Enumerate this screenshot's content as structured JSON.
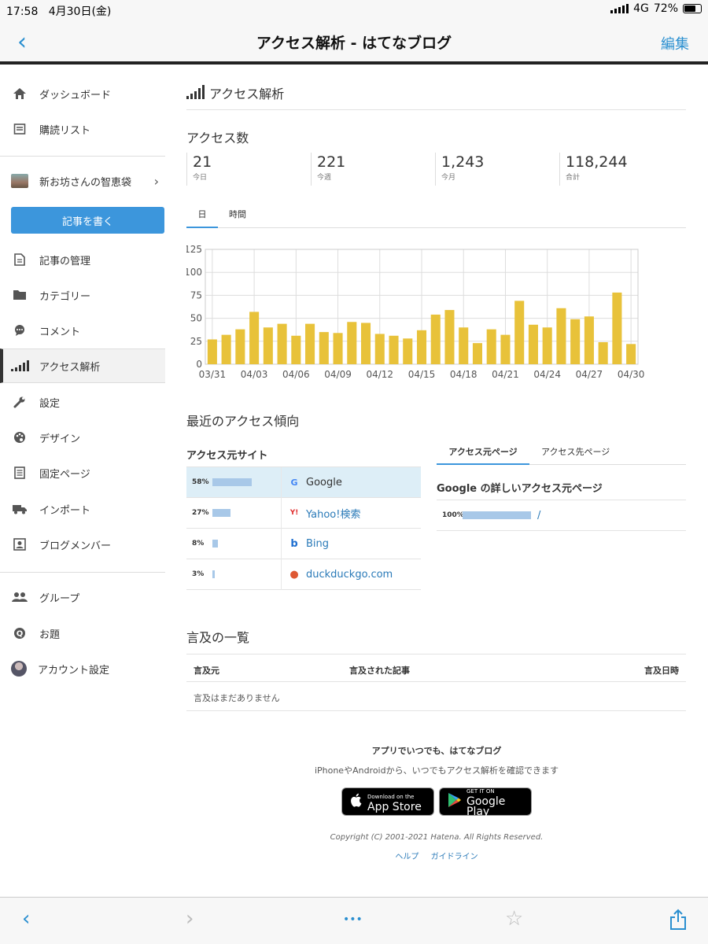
{
  "status": {
    "time": "17:58",
    "date": "4月30日(金)",
    "network": "4G",
    "battery": "72%",
    "battery_level": 0.72
  },
  "nav": {
    "back": "‹",
    "title": "アクセス解析 - はてなブログ",
    "edit": "編集"
  },
  "sidebar": {
    "items": [
      {
        "label": "ダッシュボード",
        "icon": "home-icon"
      },
      {
        "label": "購読リスト",
        "icon": "inbox-icon"
      },
      {
        "label": "新お坊さんの智恵袋",
        "icon": "blog-thumbnail"
      },
      {
        "label": "記事を書く"
      },
      {
        "label": "記事の管理",
        "icon": "document-icon"
      },
      {
        "label": "カテゴリー",
        "icon": "folder-icon"
      },
      {
        "label": "コメント",
        "icon": "comment-icon"
      },
      {
        "label": "アクセス解析",
        "icon": "signal-bars-icon"
      },
      {
        "label": "設定",
        "icon": "wrench-icon"
      },
      {
        "label": "デザイン",
        "icon": "palette-icon"
      },
      {
        "label": "固定ページ",
        "icon": "page-icon"
      },
      {
        "label": "インポート",
        "icon": "truck-icon"
      },
      {
        "label": "ブログメンバー",
        "icon": "member-icon"
      },
      {
        "label": "グループ",
        "icon": "group-icon"
      },
      {
        "label": "お題",
        "icon": "question-icon"
      },
      {
        "label": "アカウント設定",
        "icon": "avatar-icon"
      }
    ]
  },
  "main": {
    "heading": "アクセス解析",
    "access_title": "アクセス数",
    "stats": [
      {
        "value": "21",
        "label": "今日"
      },
      {
        "value": "221",
        "label": "今週"
      },
      {
        "value": "1,243",
        "label": "今月"
      },
      {
        "value": "118,244",
        "label": "合計"
      }
    ],
    "tabs": [
      "日",
      "時間"
    ],
    "trend_title": "最近のアクセス傾向",
    "sources_title": "アクセス元サイト",
    "sources": [
      {
        "pct": "58%",
        "value": 58,
        "site": "Google",
        "icon": "G"
      },
      {
        "pct": "27%",
        "value": 27,
        "site": "Yahoo!検索",
        "icon": "Y!"
      },
      {
        "pct": "8%",
        "value": 8,
        "site": "Bing",
        "icon": "b"
      },
      {
        "pct": "3%",
        "value": 3,
        "site": "duckduckgo.com",
        "icon": "●"
      }
    ],
    "right_tabs": [
      "アクセス元ページ",
      "アクセス先ページ"
    ],
    "detail_title": "Google の詳しいアクセス元ページ",
    "detail_rows": [
      {
        "pct": "100%",
        "value": 100,
        "path": "/"
      }
    ],
    "mentions_title": "言及の一覧",
    "mentions_headers": [
      "言及元",
      "言及された記事",
      "言及日時"
    ],
    "mentions_empty": "言及はまだありません"
  },
  "chart_data": {
    "type": "bar",
    "categories": [
      "03/31",
      "04/01",
      "04/02",
      "04/03",
      "04/04",
      "04/05",
      "04/06",
      "04/07",
      "04/08",
      "04/09",
      "04/10",
      "04/11",
      "04/12",
      "04/13",
      "04/14",
      "04/15",
      "04/16",
      "04/17",
      "04/18",
      "04/19",
      "04/20",
      "04/21",
      "04/22",
      "04/23",
      "04/24",
      "04/25",
      "04/26",
      "04/27",
      "04/28",
      "04/29",
      "04/30"
    ],
    "tick_labels": [
      "03/31",
      "04/03",
      "04/06",
      "04/09",
      "04/12",
      "04/15",
      "04/18",
      "04/21",
      "04/24",
      "04/27",
      "04/30"
    ],
    "values": [
      27,
      32,
      38,
      57,
      40,
      44,
      31,
      44,
      35,
      34,
      46,
      45,
      33,
      31,
      28,
      37,
      54,
      59,
      40,
      23,
      38,
      32,
      69,
      43,
      40,
      61,
      49,
      52,
      24,
      78,
      22
    ],
    "ylim": [
      0,
      125
    ],
    "yticks": [
      0,
      25,
      50,
      75,
      100,
      125
    ],
    "bar_color": "#e8c23a",
    "grid": true
  },
  "footer": {
    "line1": "アプリでいつでも、はてなブログ",
    "line2": "iPhoneやAndroidから、いつでもアクセス解析を確認できます",
    "appstore_small": "Download on the",
    "appstore": "App Store",
    "gplay_small": "GET IT ON",
    "gplay": "Google Play",
    "copyright": "Copyright (C) 2001-2021 Hatena. All Rights Reserved.",
    "links": [
      "ヘルプ",
      "ガイドライン"
    ]
  },
  "toolbar": {
    "back": "‹",
    "forward": "›",
    "more": "•••",
    "star": "☆",
    "share": "share-icon"
  }
}
